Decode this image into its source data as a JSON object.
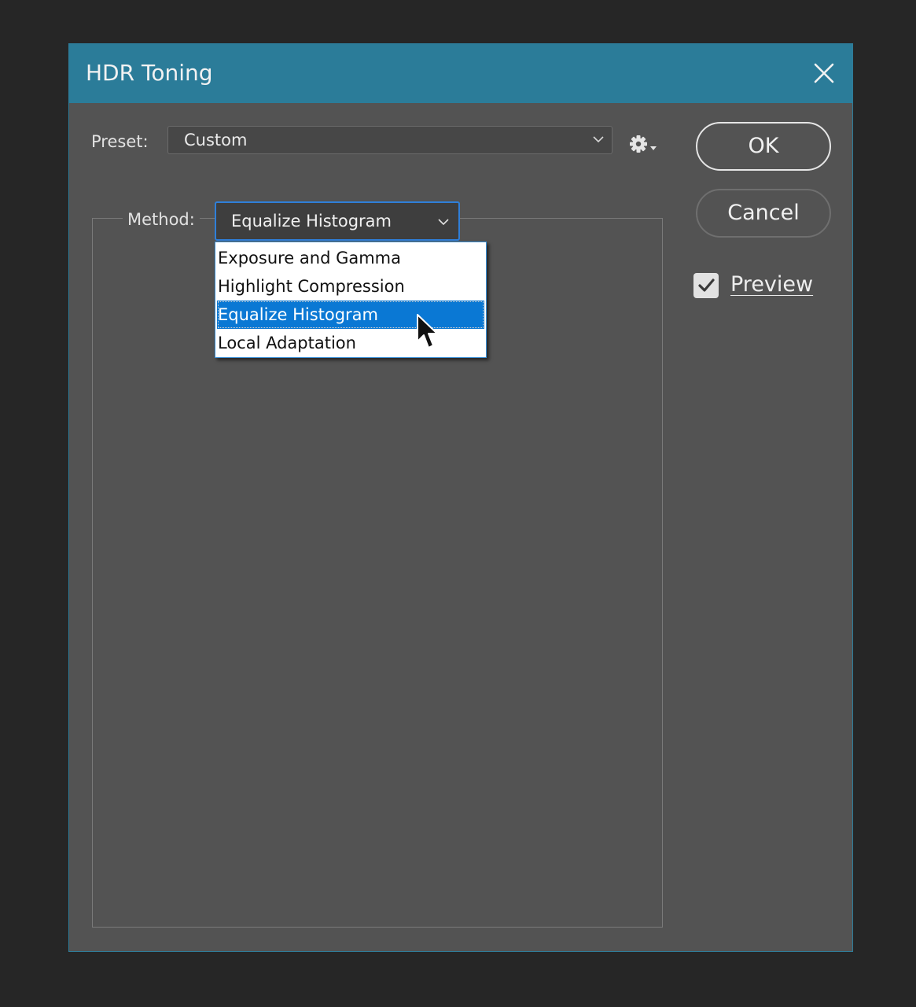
{
  "window": {
    "title": "HDR Toning",
    "close_icon": "close-icon"
  },
  "preset": {
    "label": "Preset:",
    "value": "Custom",
    "chevron_icon": "chevron-down-icon",
    "gear_icon": "gear-icon"
  },
  "method": {
    "label": "Method:",
    "value": "Equalize Histogram",
    "chevron_icon": "chevron-down-icon",
    "options": [
      {
        "label": "Exposure and Gamma",
        "selected": false
      },
      {
        "label": "Highlight Compression",
        "selected": false
      },
      {
        "label": "Equalize Histogram",
        "selected": true
      },
      {
        "label": "Local Adaptation",
        "selected": false
      }
    ]
  },
  "buttons": {
    "ok_label": "OK",
    "cancel_label": "Cancel"
  },
  "preview": {
    "label": "Preview",
    "checked": true
  },
  "colors": {
    "titlebar": "#2b7c99",
    "dialog_bg": "#535353",
    "selection": "#0a78d4",
    "focus_border": "#2f7fd9"
  }
}
